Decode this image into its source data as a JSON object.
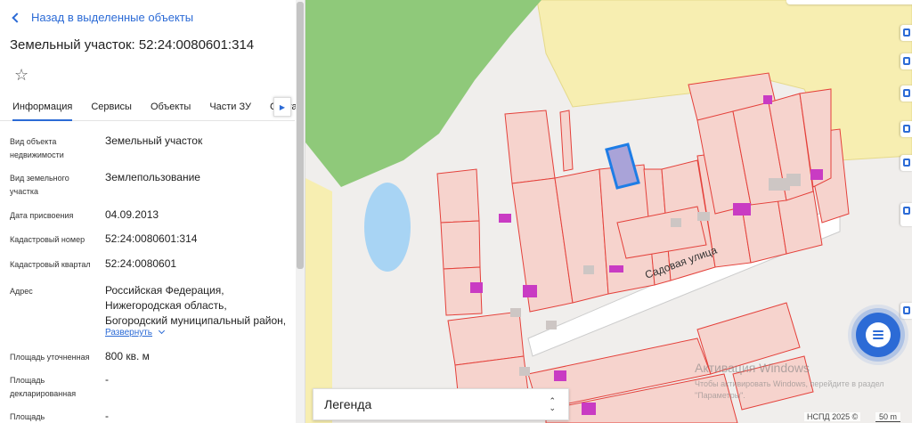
{
  "panel": {
    "back_label": "Назад в выделенные объекты",
    "title": "Земельный участок: 52:24:0080601:314",
    "favorite_icon": "star-icon",
    "tabs": [
      {
        "label": "Информация",
        "active": true
      },
      {
        "label": "Сервисы"
      },
      {
        "label": "Объекты"
      },
      {
        "label": "Части ЗУ"
      },
      {
        "label": "Соста"
      }
    ],
    "properties": [
      {
        "label": "Вид объекта недвижимости",
        "value": "Земельный участок"
      },
      {
        "label": "Вид земельного участка",
        "value": "Землепользование"
      },
      {
        "label": "Дата присвоения",
        "value": "04.09.2013"
      },
      {
        "label": "Кадастровый номер",
        "value": "52:24:0080601:314"
      },
      {
        "label": "Кадастровый квартал",
        "value": "52:24:0080601"
      },
      {
        "label": "Адрес",
        "value": "Российская Федерация, Нижегородская область, Богородский муниципальный район,"
      },
      {
        "label": "Площадь уточненная",
        "value": "800 кв. м"
      },
      {
        "label": "Площадь декларированная",
        "value": "-"
      },
      {
        "label": "Площадь",
        "value": "-"
      }
    ],
    "expand_label": "Развернуть"
  },
  "map": {
    "street_label": "Садовая улица",
    "legend_label": "Легенда",
    "watermark_title": "Активация Windows",
    "watermark_text": "Чтобы активировать Windows, перейдите в раздел \"Параметры\".",
    "attribution": "НСПД 2025 ©",
    "scale_label": "50 m",
    "colors": {
      "forest": "#8fc97a",
      "farmland": "#f7eeb1",
      "settlement": "#f0eeec",
      "water": "#a8d4f4",
      "parcel_fill": "#f6d3cd",
      "parcel_stroke": "#e4403a",
      "building": "#c93bc3",
      "selected": "#1e7de6",
      "accent": "#2c6bd6"
    }
  }
}
